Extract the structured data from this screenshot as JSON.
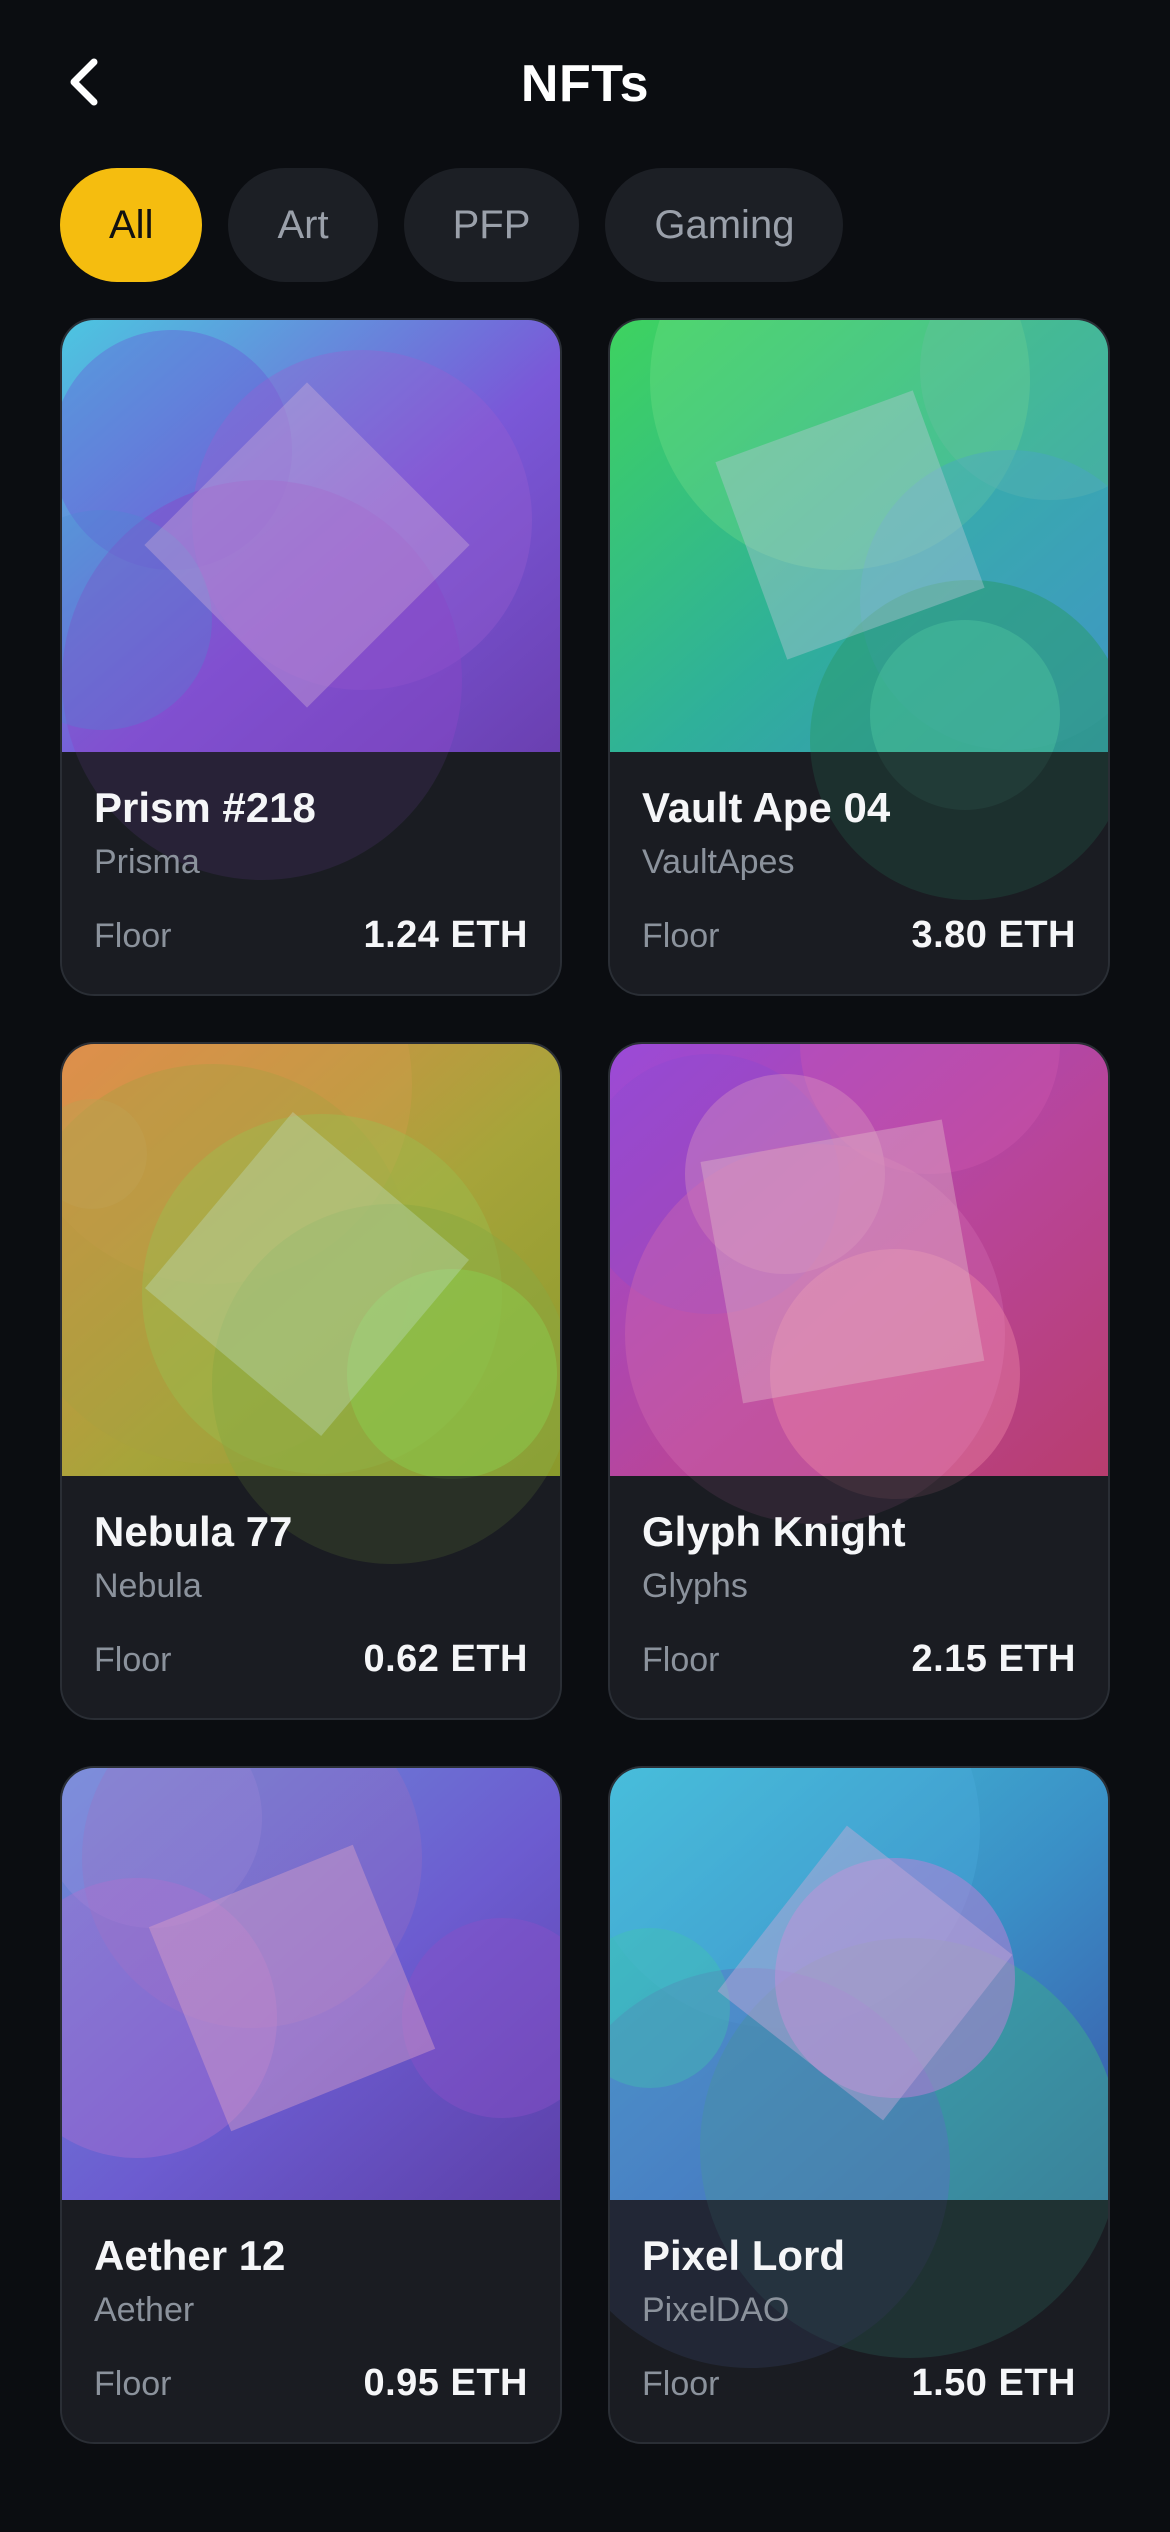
{
  "header": {
    "title": "NFTs",
    "back_icon": "chevron-left-icon"
  },
  "filters": [
    {
      "label": "All",
      "active": true
    },
    {
      "label": "Art",
      "active": false
    },
    {
      "label": "PFP",
      "active": false
    },
    {
      "label": "Gaming",
      "active": false
    }
  ],
  "colors": {
    "background": "#0b0d11",
    "accent": "#f5bd0f",
    "card": "#191c21",
    "chip": "#1c1f25",
    "muted_text": "#8b929c"
  },
  "floor_label": "Floor",
  "nfts": [
    {
      "name": "Prism #218",
      "collection": "Prisma",
      "floor": "1.24 ETH",
      "gradient": [
        "#4cc6e0",
        "#7a58d8",
        "#6a3fb0"
      ]
    },
    {
      "name": "Vault Ape 04",
      "collection": "VaultApes",
      "floor": "3.80 ETH",
      "gradient": [
        "#3ed35f",
        "#2fb09a",
        "#3b8fc0"
      ]
    },
    {
      "name": "Nebula 77",
      "collection": "Nebula",
      "floor": "0.62 ETH",
      "gradient": [
        "#e2894a",
        "#a7a43a",
        "#8a9a2c"
      ]
    },
    {
      "name": "Glyph Knight",
      "collection": "Glyphs",
      "floor": "2.15 ETH",
      "gradient": [
        "#9a4ad8",
        "#b8459a",
        "#b83d6e"
      ]
    },
    {
      "name": "Aether 12",
      "collection": "Aether",
      "floor": "0.95 ETH",
      "gradient": [
        "#6d8fd8",
        "#6c5cd0",
        "#5c3fa8"
      ]
    },
    {
      "name": "Pixel Lord",
      "collection": "PixelDAO",
      "floor": "1.50 ETH",
      "gradient": [
        "#45c4d8",
        "#3a8fc6",
        "#3a55a8"
      ]
    }
  ]
}
